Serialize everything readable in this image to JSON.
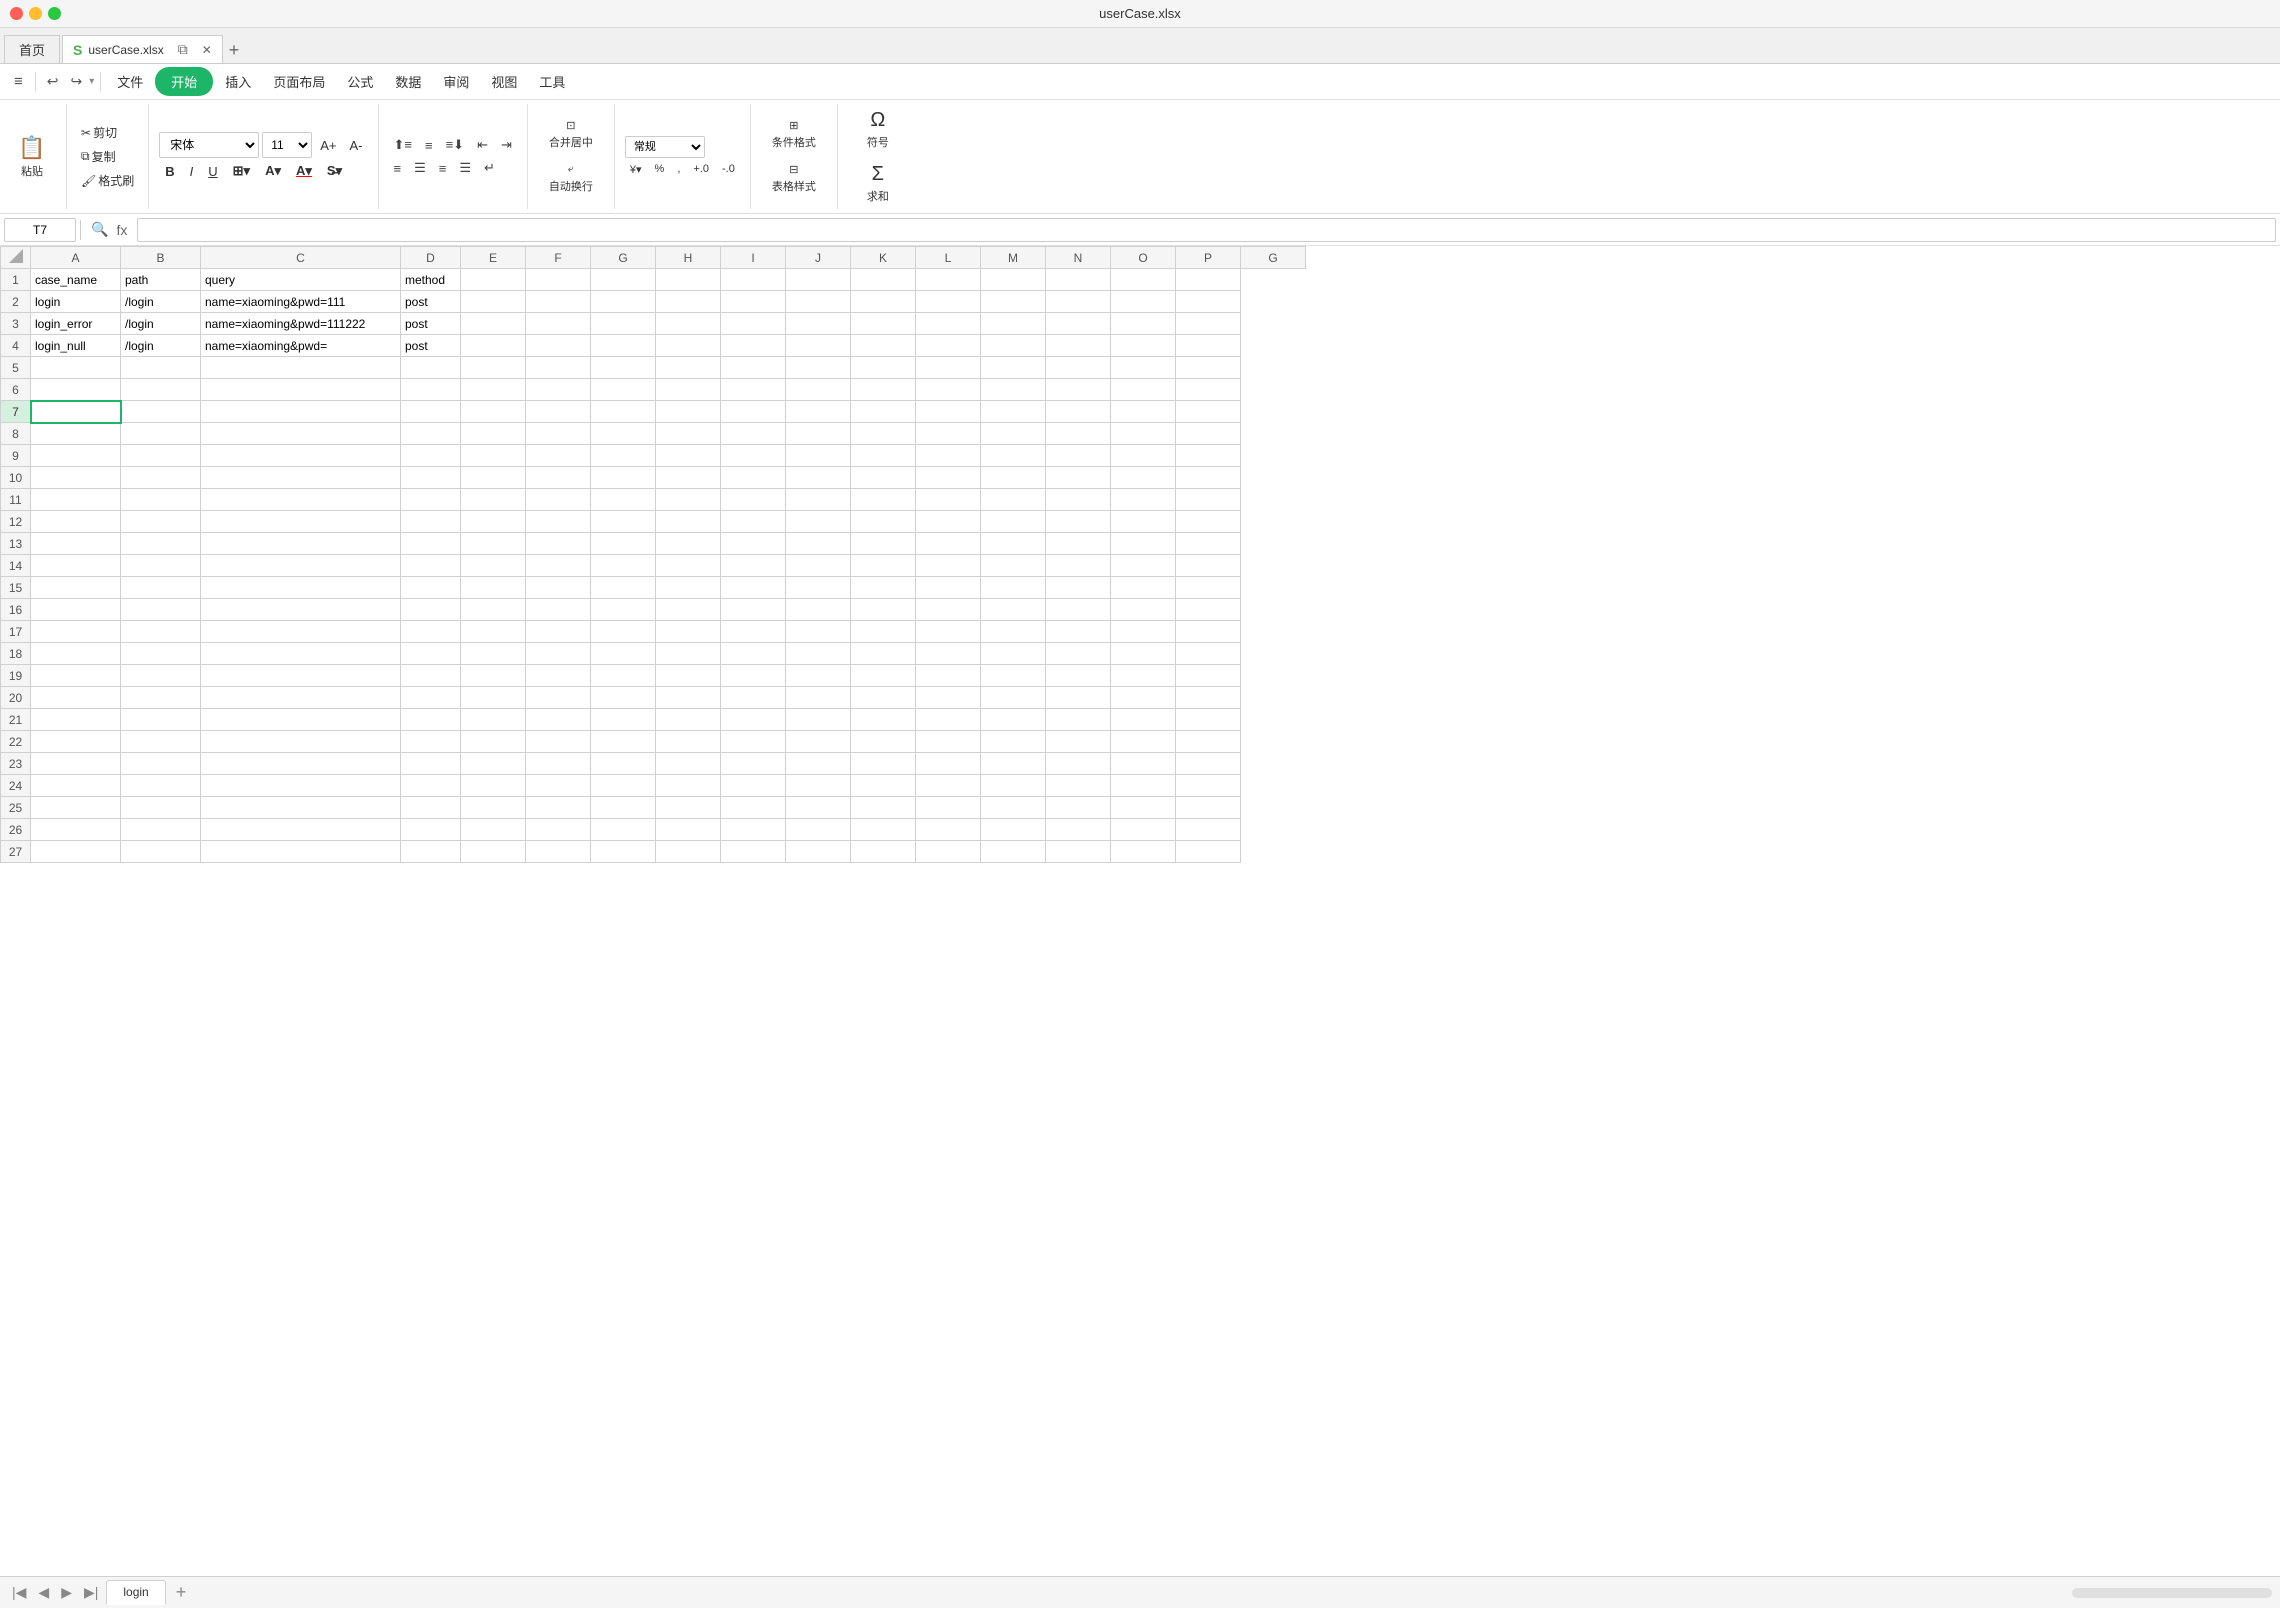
{
  "window": {
    "title": "userCase.xlsx"
  },
  "tabs": {
    "home_label": "首页",
    "file_label": "userCase.xlsx",
    "wps_icon": "S"
  },
  "menu": {
    "hamburger": "≡",
    "items": [
      "文件",
      "开始",
      "插入",
      "页面布局",
      "公式",
      "数据",
      "审阅",
      "视图",
      "工具"
    ],
    "active_index": 1,
    "undo": "↩",
    "redo": "↪",
    "undo_drop": "▾",
    "redo_drop": "▾"
  },
  "toolbar": {
    "paste_label": "粘贴",
    "cut_label": "剪切",
    "copy_label": "复制",
    "format_painter_label": "格式刷",
    "font_name": "宋体",
    "font_size": "11",
    "font_size_increase": "A↑",
    "font_size_decrease": "A↓",
    "bold": "B",
    "italic": "I",
    "underline": "U",
    "border_btn": "⊞",
    "fill_color_btn": "A",
    "font_color_btn": "A",
    "strikethrough": "S̶",
    "align_top": "≡↑",
    "align_middle": "≡",
    "align_bottom": "≡↓",
    "align_left": "≡",
    "align_center": "≡",
    "align_right": "≡",
    "align_distribute": "≡",
    "wrap_text": "↵",
    "merge_label": "合并居中",
    "auto_break_label": "自动换行",
    "number_format": "常规",
    "percent_btn": "%",
    "comma_btn": ",",
    "increase_decimal": "+.0",
    "decrease_decimal": "-.0",
    "currency_btn": "¥",
    "conditional_format_label": "条件格式",
    "table_style_label": "表格样式",
    "symbol_label": "符号",
    "sum_label": "求和"
  },
  "formula_bar": {
    "cell_ref": "T7",
    "zoom_icon": "🔍",
    "formula_icon": "fx",
    "value": ""
  },
  "columns": {
    "headers": [
      "A",
      "B",
      "C",
      "D",
      "E",
      "F",
      "G",
      "H",
      "I",
      "J",
      "K",
      "L",
      "M",
      "N",
      "O",
      "P",
      "G"
    ]
  },
  "rows": {
    "count": 27,
    "data": [
      [
        "case_name",
        "path",
        "query",
        "method",
        "",
        "",
        "",
        "",
        "",
        "",
        "",
        "",
        "",
        "",
        "",
        ""
      ],
      [
        "login",
        "/login",
        "name=xiaoming&pwd=111",
        "post",
        "",
        "",
        "",
        "",
        "",
        "",
        "",
        "",
        "",
        "",
        "",
        ""
      ],
      [
        "login_error",
        "/login",
        "name=xiaoming&pwd=111222",
        "post",
        "",
        "",
        "",
        "",
        "",
        "",
        "",
        "",
        "",
        "",
        "",
        ""
      ],
      [
        "login_null",
        "/login",
        "name=xiaoming&pwd=",
        "post",
        "",
        "",
        "",
        "",
        "",
        "",
        "",
        "",
        "",
        "",
        "",
        ""
      ],
      [
        "",
        "",
        "",
        "",
        "",
        "",
        "",
        "",
        "",
        "",
        "",
        "",
        "",
        "",
        "",
        ""
      ],
      [
        "",
        "",
        "",
        "",
        "",
        "",
        "",
        "",
        "",
        "",
        "",
        "",
        "",
        "",
        "",
        ""
      ],
      [
        "",
        "",
        "",
        "",
        "",
        "",
        "",
        "",
        "",
        "",
        "",
        "",
        "",
        "",
        "",
        ""
      ],
      [
        "",
        "",
        "",
        "",
        "",
        "",
        "",
        "",
        "",
        "",
        "",
        "",
        "",
        "",
        "",
        ""
      ],
      [
        "",
        "",
        "",
        "",
        "",
        "",
        "",
        "",
        "",
        "",
        "",
        "",
        "",
        "",
        "",
        ""
      ],
      [
        "",
        "",
        "",
        "",
        "",
        "",
        "",
        "",
        "",
        "",
        "",
        "",
        "",
        "",
        "",
        ""
      ],
      [
        "",
        "",
        "",
        "",
        "",
        "",
        "",
        "",
        "",
        "",
        "",
        "",
        "",
        "",
        "",
        ""
      ],
      [
        "",
        "",
        "",
        "",
        "",
        "",
        "",
        "",
        "",
        "",
        "",
        "",
        "",
        "",
        "",
        ""
      ],
      [
        "",
        "",
        "",
        "",
        "",
        "",
        "",
        "",
        "",
        "",
        "",
        "",
        "",
        "",
        "",
        ""
      ],
      [
        "",
        "",
        "",
        "",
        "",
        "",
        "",
        "",
        "",
        "",
        "",
        "",
        "",
        "",
        "",
        ""
      ],
      [
        "",
        "",
        "",
        "",
        "",
        "",
        "",
        "",
        "",
        "",
        "",
        "",
        "",
        "",
        "",
        ""
      ],
      [
        "",
        "",
        "",
        "",
        "",
        "",
        "",
        "",
        "",
        "",
        "",
        "",
        "",
        "",
        "",
        ""
      ],
      [
        "",
        "",
        "",
        "",
        "",
        "",
        "",
        "",
        "",
        "",
        "",
        "",
        "",
        "",
        "",
        ""
      ],
      [
        "",
        "",
        "",
        "",
        "",
        "",
        "",
        "",
        "",
        "",
        "",
        "",
        "",
        "",
        "",
        ""
      ],
      [
        "",
        "",
        "",
        "",
        "",
        "",
        "",
        "",
        "",
        "",
        "",
        "",
        "",
        "",
        "",
        ""
      ],
      [
        "",
        "",
        "",
        "",
        "",
        "",
        "",
        "",
        "",
        "",
        "",
        "",
        "",
        "",
        "",
        ""
      ],
      [
        "",
        "",
        "",
        "",
        "",
        "",
        "",
        "",
        "",
        "",
        "",
        "",
        "",
        "",
        "",
        ""
      ],
      [
        "",
        "",
        "",
        "",
        "",
        "",
        "",
        "",
        "",
        "",
        "",
        "",
        "",
        "",
        "",
        ""
      ],
      [
        "",
        "",
        "",
        "",
        "",
        "",
        "",
        "",
        "",
        "",
        "",
        "",
        "",
        "",
        "",
        ""
      ],
      [
        "",
        "",
        "",
        "",
        "",
        "",
        "",
        "",
        "",
        "",
        "",
        "",
        "",
        "",
        "",
        ""
      ],
      [
        "",
        "",
        "",
        "",
        "",
        "",
        "",
        "",
        "",
        "",
        "",
        "",
        "",
        "",
        "",
        ""
      ],
      [
        "",
        "",
        "",
        "",
        "",
        "",
        "",
        "",
        "",
        "",
        "",
        "",
        "",
        "",
        "",
        ""
      ],
      [
        "",
        "",
        "",
        "",
        "",
        "",
        "",
        "",
        "",
        "",
        "",
        "",
        "",
        "",
        "",
        ""
      ]
    ]
  },
  "sheet_tabs": {
    "sheets": [
      "login"
    ],
    "active": "login",
    "add_label": "+"
  },
  "active_cell": {
    "row": 7,
    "col": 0
  }
}
